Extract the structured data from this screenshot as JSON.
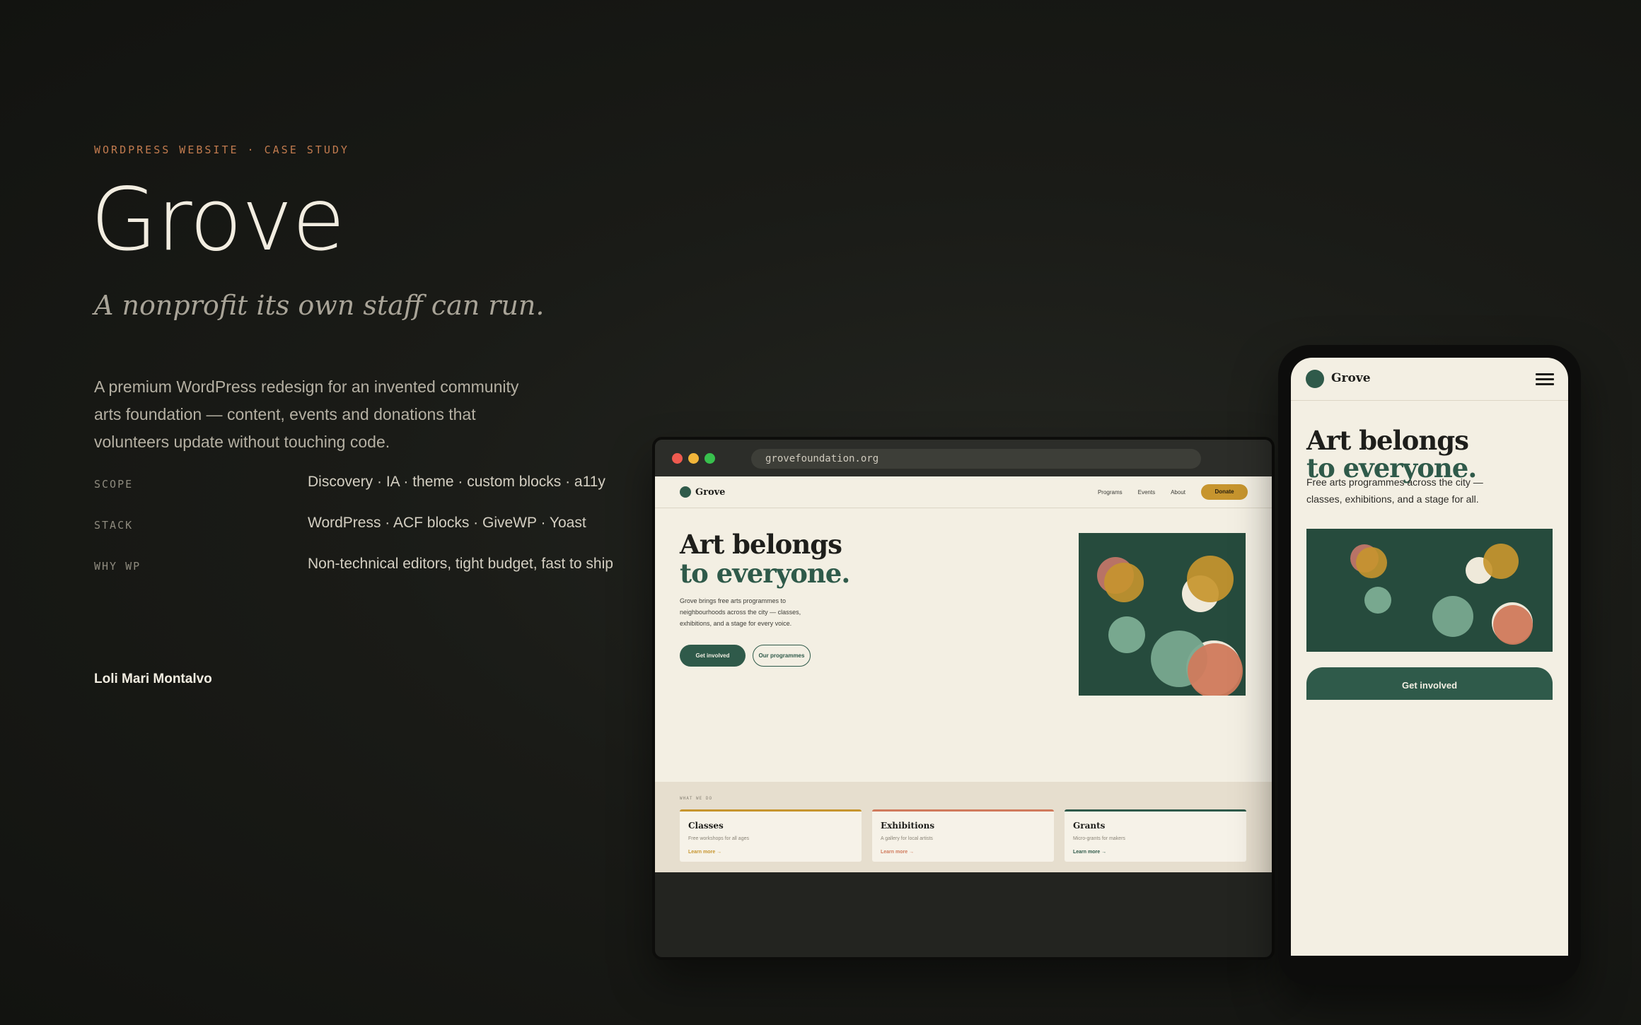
{
  "case": {
    "eyebrow": "WORDPRESS WEBSITE · CASE STUDY",
    "title": "Grove",
    "tagline": "A nonprofit its own staff can run.",
    "description": "A premium WordPress redesign for an invented community arts foundation — content, events and donations that volunteers update without touching code.",
    "meta": [
      {
        "key": "SCOPE",
        "value": "Discovery · IA · theme · custom blocks · a11y"
      },
      {
        "key": "STACK",
        "value": "WordPress · ACF blocks · GiveWP · Yoast"
      },
      {
        "key": "WHY WP",
        "value": "Non-technical editors, tight budget, fast to ship"
      }
    ],
    "author": "Loli Mari Montalvo"
  },
  "browser": {
    "url": "grovefoundation.org",
    "site": {
      "logo": "Grove",
      "nav": [
        "Programs",
        "Events",
        "About"
      ],
      "donate": "Donate",
      "hero_line1": "Art belongs",
      "hero_line2": "to everyone.",
      "hero_text": "Grove brings free arts programmes to neighbourhoods across the city — classes, exhibitions, and a stage for every voice.",
      "cta_primary": "Get involved",
      "cta_secondary": "Our programmes",
      "section_label": "WHAT WE DO",
      "cards": [
        {
          "title": "Classes",
          "sub": "Free workshops for all ages",
          "link": "Learn more →",
          "accent": "#c7952e"
        },
        {
          "title": "Exhibitions",
          "sub": "A gallery for local artists",
          "link": "Learn more →",
          "accent": "#d07a5c"
        },
        {
          "title": "Grants",
          "sub": "Micro-grants for makers",
          "link": "Learn more →",
          "accent": "#2f5a4a"
        }
      ]
    }
  },
  "phone": {
    "logo": "Grove",
    "hero_line1": "Art belongs",
    "hero_line2": "to everyone.",
    "hero_text": "Free arts programmes across the city — classes, exhibitions, and a stage for all.",
    "cta": "Get involved"
  },
  "colors": {
    "background": "#161714",
    "accent_green": "#2f5a4a",
    "accent_gold": "#c7952e",
    "accent_coral": "#d07a5c",
    "cream": "#f3efe3",
    "eyebrow": "#c07a4e"
  }
}
